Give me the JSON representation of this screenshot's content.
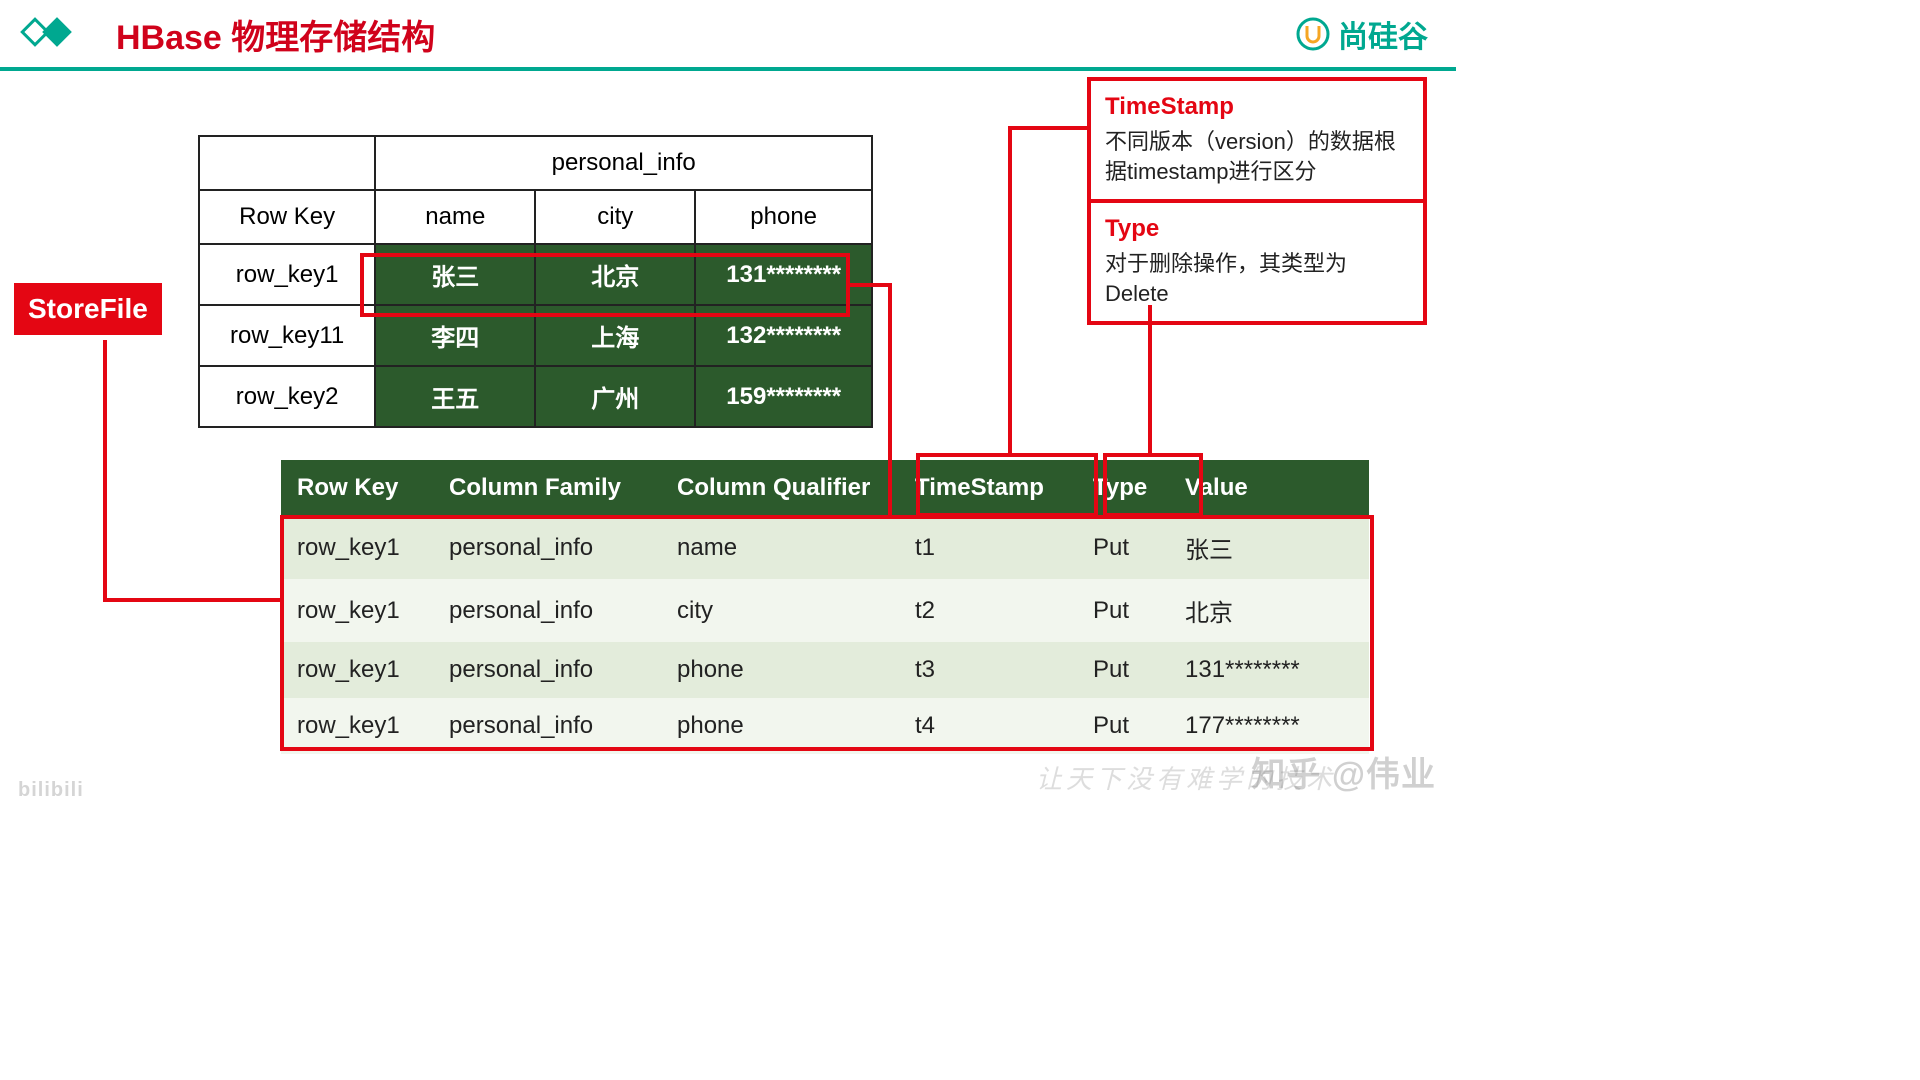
{
  "header": {
    "title": "HBase 物理存储结构",
    "brand": "尚硅谷"
  },
  "storefile_label": "StoreFile",
  "upper_table": {
    "cf_header": "personal_info",
    "rowkey_header": "Row Key",
    "columns": [
      "name",
      "city",
      "phone"
    ],
    "rows": [
      {
        "rowkey": "row_key1",
        "values": [
          "张三",
          "北京",
          "131********"
        ]
      },
      {
        "rowkey": "row_key11",
        "values": [
          "李四",
          "上海",
          "132********"
        ]
      },
      {
        "rowkey": "row_key2",
        "values": [
          "王五",
          "广州",
          "159********"
        ]
      }
    ]
  },
  "lower_table": {
    "headers": [
      "Row Key",
      "Column Family",
      "Column Qualifier",
      "TimeStamp",
      "Type",
      "Value"
    ],
    "rows": [
      [
        "row_key1",
        "personal_info",
        "name",
        "t1",
        "Put",
        "张三"
      ],
      [
        "row_key1",
        "personal_info",
        "city",
        "t2",
        "Put",
        "北京"
      ],
      [
        "row_key1",
        "personal_info",
        "phone",
        "t3",
        "Put",
        "131********"
      ],
      [
        "row_key1",
        "personal_info",
        "phone",
        "t4",
        "Put",
        "177********"
      ]
    ]
  },
  "callouts": {
    "timestamp": {
      "title": "TimeStamp",
      "body": "不同版本（version）的数据根据timestamp进行区分"
    },
    "type": {
      "title": "Type",
      "body": "对于删除操作，其类型为Delete"
    }
  },
  "watermark": "知乎 @伟业",
  "footer_motto": "让天下没有难学的技术",
  "bili": "bilibili"
}
